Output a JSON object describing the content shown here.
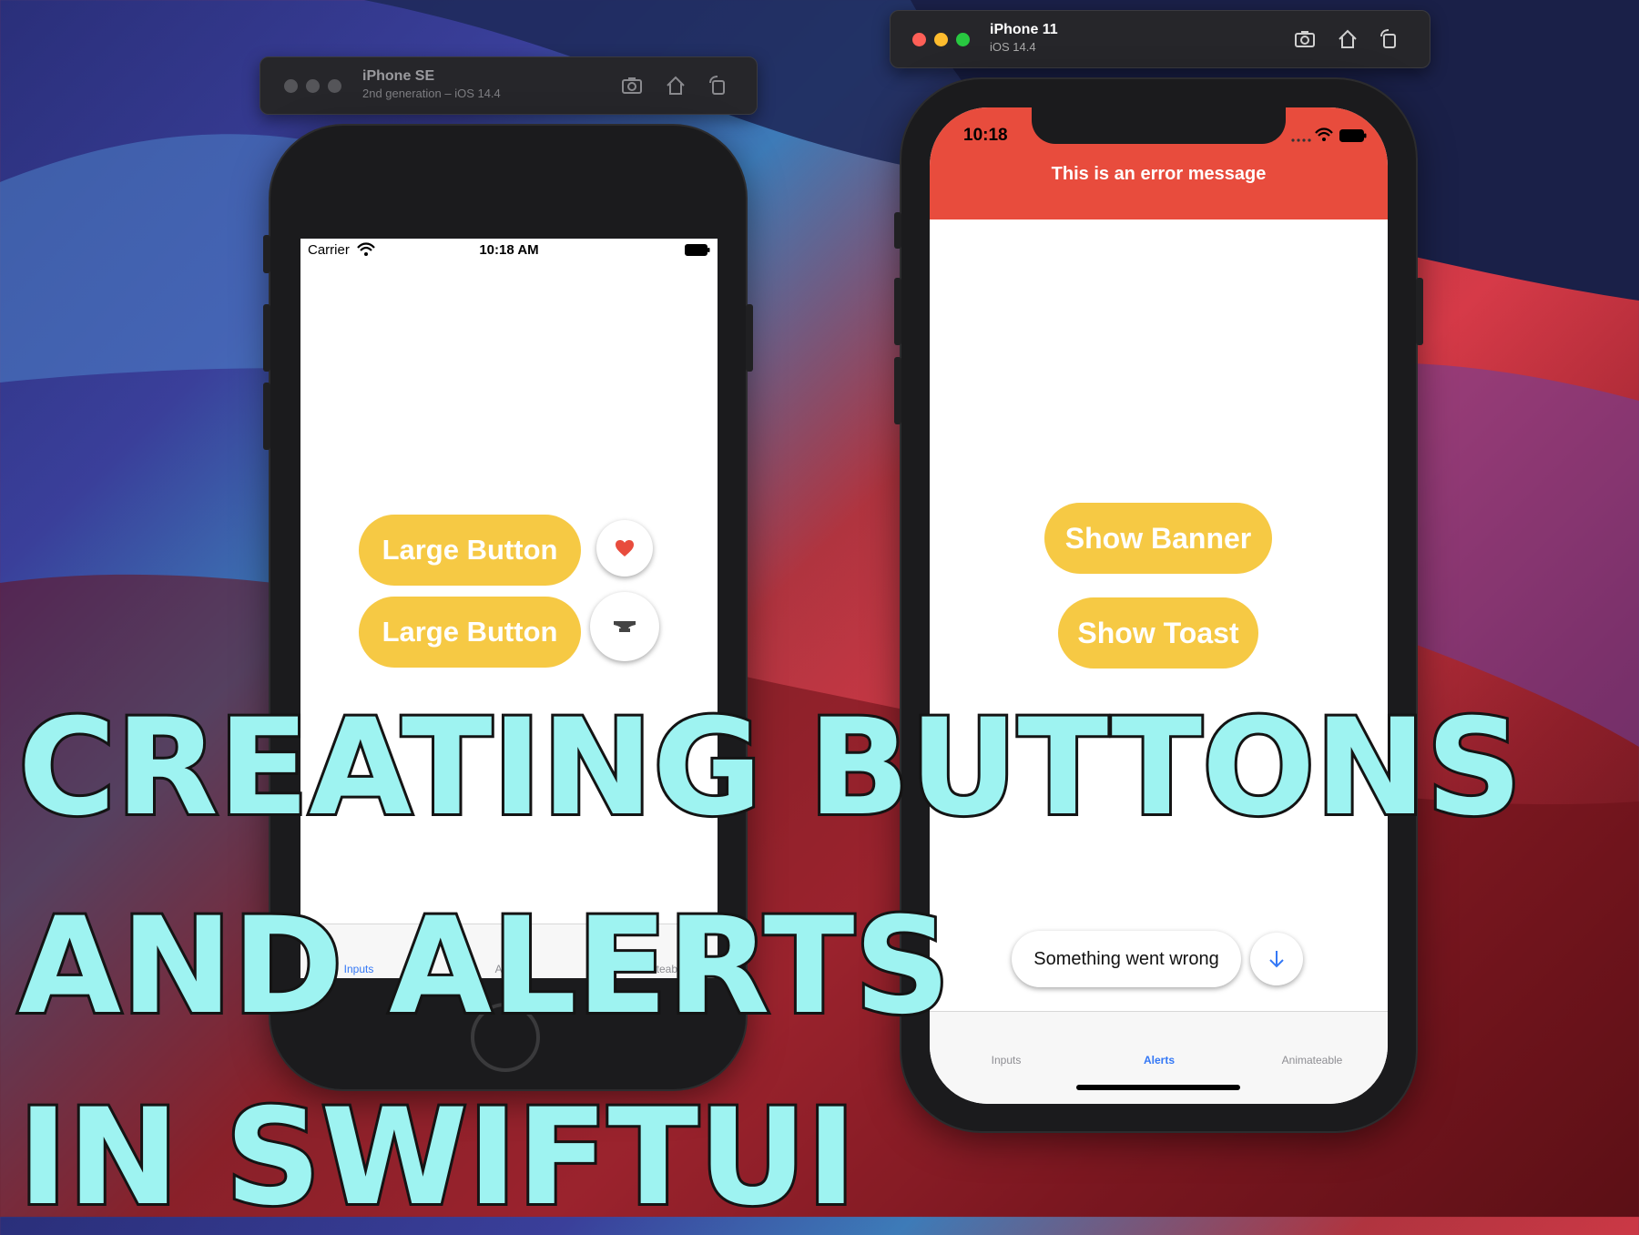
{
  "left_window": {
    "title": "iPhone SE",
    "subtitle": "2nd generation – iOS 14.4",
    "status": {
      "carrier": "Carrier",
      "time": "10:18 AM"
    },
    "buttons": {
      "large_1": "Large Button",
      "large_2": "Large Button"
    },
    "tabs": [
      "Inputs",
      "Alerts",
      "Animateable"
    ]
  },
  "right_window": {
    "title": "iPhone 11",
    "subtitle": "iOS 14.4",
    "status": {
      "time": "10:18"
    },
    "banner": {
      "message": "This is an error message",
      "color": "#e84c3d"
    },
    "buttons": {
      "show_banner": "Show Banner",
      "show_toast": "Show Toast"
    },
    "toast": {
      "message": "Something went wrong"
    },
    "tabs": [
      "Inputs",
      "Alerts",
      "Animateable"
    ],
    "active_tab": "Alerts"
  },
  "colors": {
    "accent_yellow": "#f6c944",
    "tab_active": "#3478f6",
    "overlay_text": "#9ef3f1"
  },
  "overlay_title": {
    "line1": "CREATING BUTTONS",
    "line2": "AND ALERTS",
    "line3": "IN SWIFTUI"
  }
}
